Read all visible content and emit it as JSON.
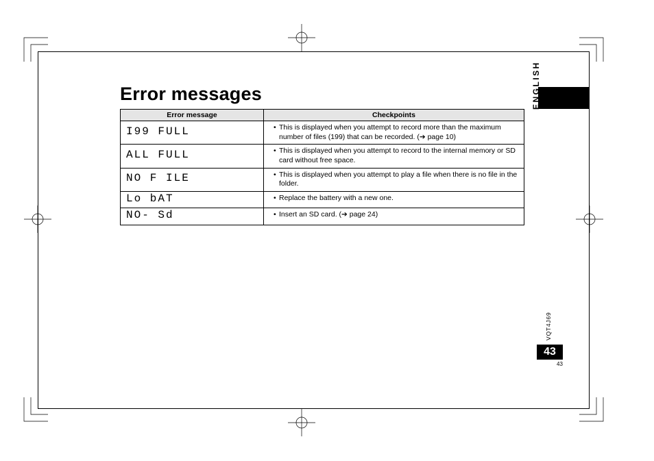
{
  "title": "Error messages",
  "language_label": "ENGLISH",
  "doc_code": "VQT4J69",
  "page_number": "43",
  "page_number_small": "43",
  "table": {
    "headers": {
      "col1": "Error message",
      "col2": "Checkpoints"
    },
    "rows": [
      {
        "message": "I99 FULL",
        "checkpoints": [
          "This is displayed when you attempt to record more than the maximum number of files (199) that can be recorded. (➔ page 10)"
        ]
      },
      {
        "message": "ALL FULL",
        "checkpoints": [
          "This is displayed when you attempt to record to the internal memory or SD card without free space."
        ]
      },
      {
        "message": "NO  F ILE",
        "checkpoints": [
          "This is displayed when you attempt to play a file when there is no file in the folder."
        ]
      },
      {
        "message": "Lo  bAT",
        "checkpoints": [
          "Replace the battery with a new one."
        ]
      },
      {
        "message": "NO- Sd",
        "checkpoints": [
          "Insert an SD card. (➔ page 24)"
        ]
      }
    ]
  }
}
